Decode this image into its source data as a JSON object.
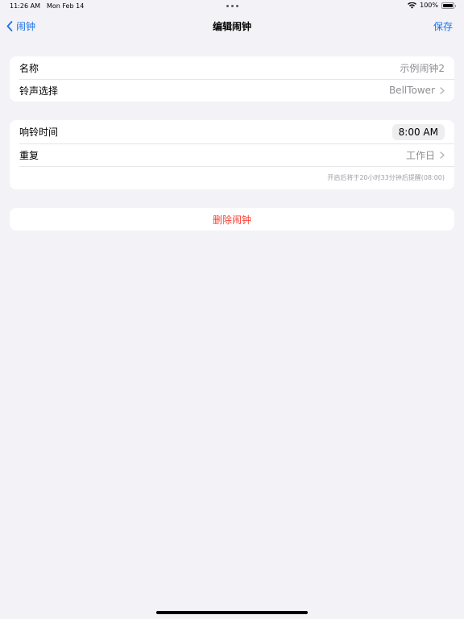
{
  "status_bar": {
    "time": "11:26 AM",
    "date": "Mon Feb 14",
    "battery": "100%",
    "icons": [
      "wifi-icon",
      "battery-icon"
    ]
  },
  "nav": {
    "back_label": "闹钟",
    "title": "编辑闹钟",
    "save_label": "保存",
    "accent_color": "#1a73e8"
  },
  "group1": {
    "name_label": "名称",
    "name_placeholder": "示例闹钟2",
    "ringtone_label": "铃声选择",
    "ringtone_value": "BellTower"
  },
  "group2": {
    "time_label": "响铃时间",
    "time_value": "8:00 AM",
    "repeat_label": "重复",
    "repeat_value": "工作日",
    "hint": "开启后将于20小时33分钟后提醒(08:00)"
  },
  "delete": {
    "label": "删除闹钟",
    "color": "#ff3b30"
  }
}
